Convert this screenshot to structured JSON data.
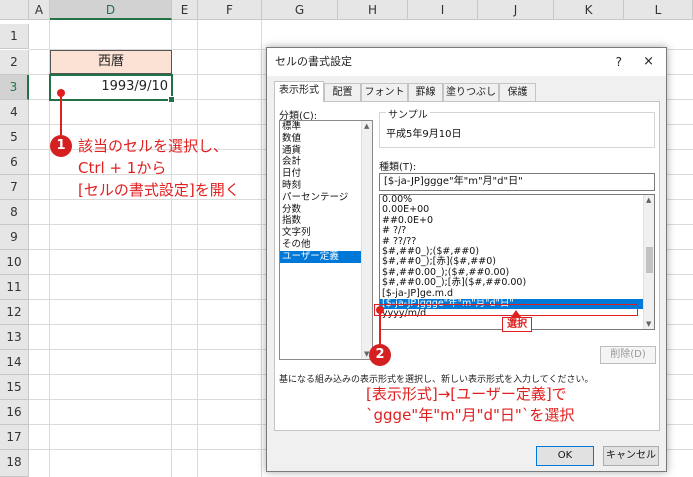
{
  "sheet": {
    "columns": [
      "A",
      "D",
      "E",
      "F",
      "G",
      "H",
      "I",
      "J",
      "K",
      "L"
    ],
    "rows": [
      "1",
      "2",
      "3",
      "4",
      "5",
      "6",
      "7",
      "8",
      "9",
      "10",
      "11",
      "12",
      "13",
      "14",
      "15",
      "16",
      "17",
      "18"
    ],
    "d2": "西暦",
    "d3": "1993/9/10"
  },
  "annotations": {
    "step1_badge": "1",
    "step1_line1": "該当のセルを選択し、",
    "step1_line2": "Ctrl + 1から",
    "step1_line3": "[セルの書式設定]を開く",
    "step2_badge": "2",
    "step2_line1": "[表示形式]→[ユーザー定義]で",
    "step2_line2": "`ggge\"年\"m\"月\"d\"日\"`を選択",
    "select_tag": "選択"
  },
  "dialog": {
    "title": "セルの書式設定",
    "help": "?",
    "close": "×",
    "tabs": [
      "表示形式",
      "配置",
      "フォント",
      "罫線",
      "塗りつぶし",
      "保護"
    ],
    "category_label": "分類(C):",
    "categories": [
      "標準",
      "数値",
      "通貨",
      "会計",
      "日付",
      "時刻",
      "パーセンテージ",
      "分数",
      "指数",
      "文字列",
      "その他",
      "ユーザー定義"
    ],
    "selected_category": "ユーザー定義",
    "sample_label": "サンプル",
    "sample_value": "平成5年9月10日",
    "type_label": "種類(T):",
    "type_value": "[$-ja-JP]ggge\"年\"m\"月\"d\"日\"",
    "formats": [
      "0.00%",
      "0.00E+00",
      "##0.0E+0",
      "# ?/?",
      "# ??/??",
      "$#,##0_);($#,##0)",
      "$#,##0_);[赤]($#,##0)",
      "$#,##0.00_);($#,##0.00)",
      "$#,##0.00_);[赤]($#,##0.00)",
      "[$-ja-JP]ge.m.d",
      "[$-ja-JP]ggge\"年\"m\"月\"d\"日\"",
      "yyyy/m/d"
    ],
    "selected_format": "[$-ja-JP]ggge\"年\"m\"月\"d\"日\"",
    "delete_button": "削除(D)",
    "description": "基になる組み込みの表示形式を選択し、新しい表示形式を入力してください。",
    "ok_button": "OK",
    "cancel_button": "キャンセル"
  },
  "colors": {
    "accent_red": "#e02020",
    "excel_green": "#217346",
    "selection_blue": "#0078d7",
    "header_fill": "#fbe2d5"
  }
}
